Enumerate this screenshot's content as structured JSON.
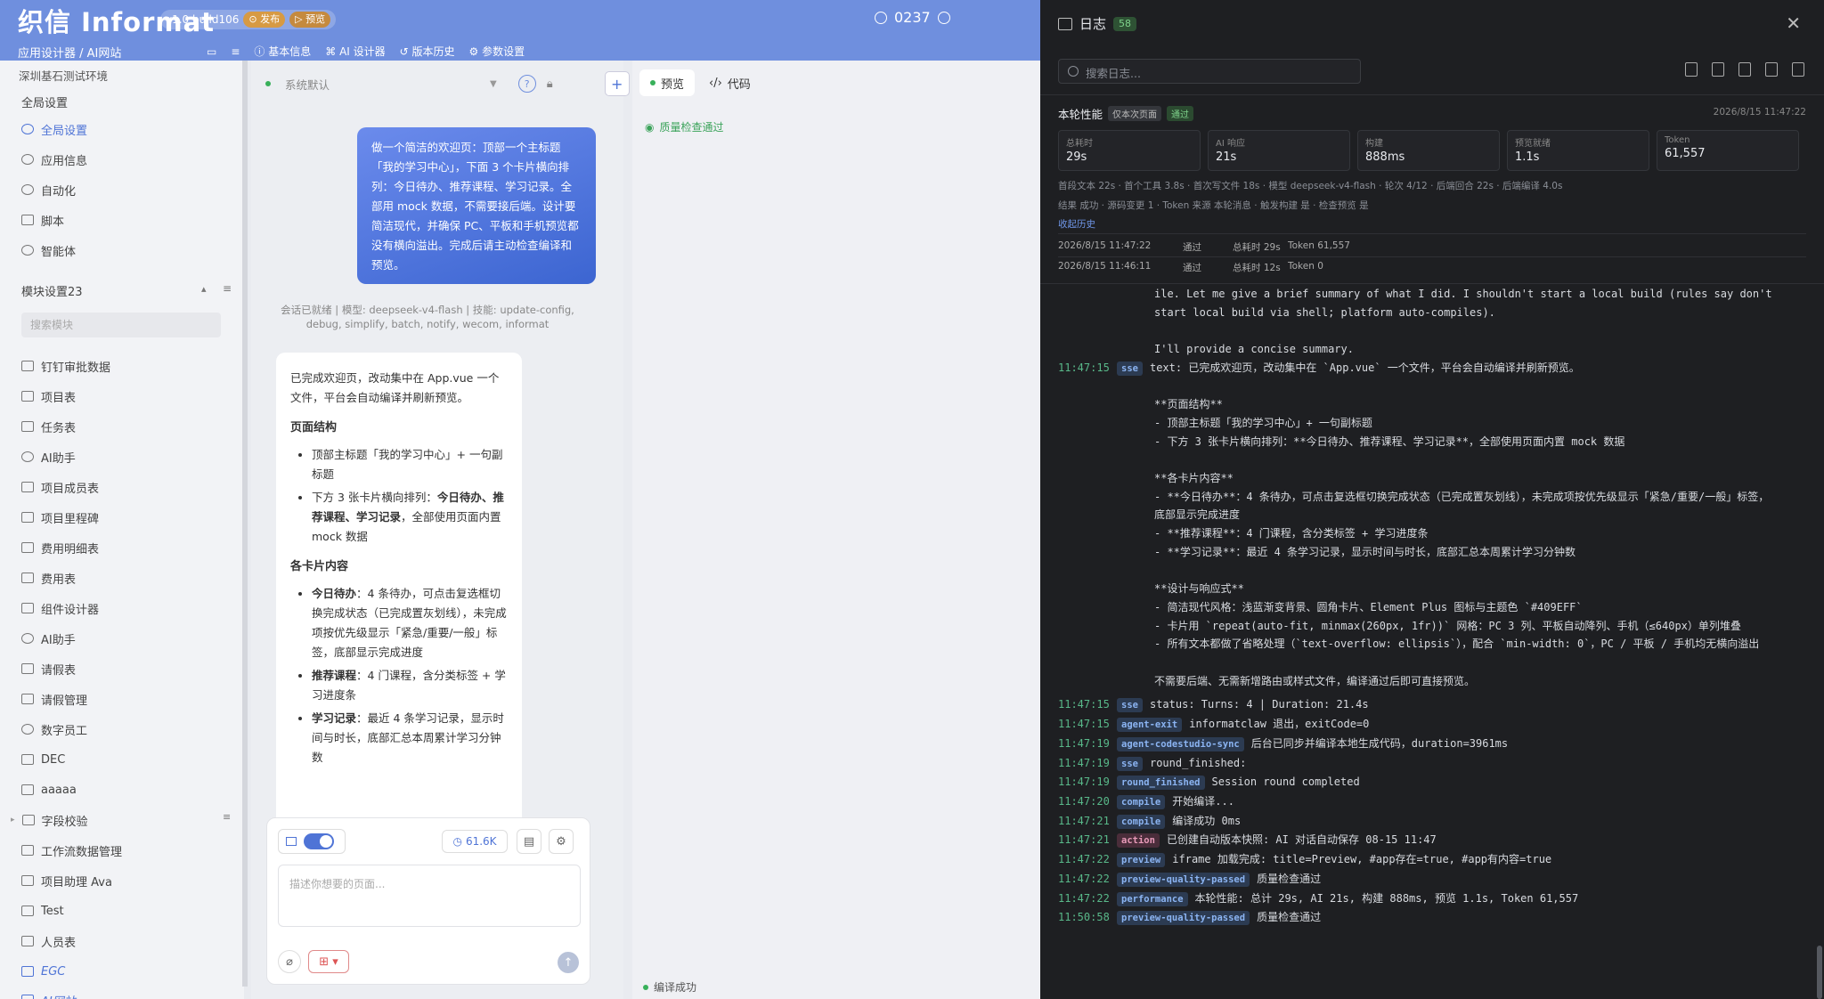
{
  "app": {
    "logo": "织信 Informat",
    "version": "v1.0 build106",
    "publish": "发布",
    "preview": "预览",
    "counter": "0237",
    "breadcrumb": "应用设计器 / AI网站",
    "nav": [
      "基本信息",
      "AI 设计器",
      "版本历史",
      "参数设置"
    ]
  },
  "sidebar": {
    "env": "深圳基石测试环境",
    "global_header": "全局设置",
    "global_items": [
      "全局设置",
      "应用信息",
      "自动化",
      "脚本",
      "智能体"
    ],
    "module_header": "模块设置23",
    "search_placeholder": "搜索模块",
    "items": [
      "钉钉审批数据",
      "项目表",
      "任务表",
      "AI助手",
      "项目成员表",
      "项目里程碑",
      "费用明细表",
      "费用表",
      "组件设计器",
      "AI助手",
      "请假表",
      "请假管理",
      "数字员工",
      "DEC",
      "aaaaa",
      "字段校验",
      "工作流数据管理",
      "项目助理 Ava",
      "Test",
      "人员表",
      "EGC",
      "AI网站"
    ]
  },
  "chat": {
    "model": "系统默认",
    "user_msg": "做一个简洁的欢迎页：顶部一个主标题「我的学习中心」，下面 3 个卡片横向排列：今日待办、推荐课程、学习记录。全部用 mock 数据，不需要接后端。设计要简洁现代，并确保 PC、平板和手机预览都没有横向溢出。完成后请主动检查编译和预览。",
    "session": "会话已就绪 | 模型: deepseek-v4-flash | 技能: update-config, debug, simplify, batch, notify, wecom, informat",
    "reply_intro": "已完成欢迎页，改动集中在 App.vue 一个文件，平台会自动编译并刷新预览。",
    "h1": "页面结构",
    "l1a": "顶部主标题「我的学习中心」+ 一句副标题",
    "l1b_pre": "下方 3 张卡片横向排列：",
    "l1b_bold": "今日待办、推荐课程、学习记录",
    "l1b_post": "，全部使用页面内置 mock 数据",
    "h2": "各卡片内容",
    "c1b": "今日待办",
    "c1": "：4 条待办，可点击复选框切换完成状态（已完成置灰划线），未完成项按优先级显示「紧急/重要/一般」标签，底部显示完成进度",
    "c2b": "推荐课程",
    "c2": "：4 门课程，含分类标签 + 学习进度条",
    "c3b": "学习记录",
    "c3": "：最近 4 条学习记录，显示时间与时长，底部汇总本周累计学习分钟数",
    "token": "61.6K",
    "input_placeholder": "描述你想要的页面..."
  },
  "preview_panel": {
    "tab_preview": "预览",
    "tab_code": "代码",
    "quality": "质量检查通过",
    "compile_status": "编译成功"
  },
  "log": {
    "title": "日志",
    "count": "58",
    "search_placeholder": "搜索日志...",
    "perf_title": "本轮性能",
    "perf_tag1": "仅本次页面",
    "perf_tag2": "通过",
    "perf_time": "2026/8/15 11:47:22",
    "cards": [
      {
        "k": "总耗时",
        "v": "29s"
      },
      {
        "k": "AI 响应",
        "v": "21s"
      },
      {
        "k": "构建",
        "v": "888ms"
      },
      {
        "k": "预览就绪",
        "v": "1.1s"
      },
      {
        "k": "Token",
        "v": "61,557"
      }
    ],
    "meta1": "首段文本 22s · 首个工具 3.8s · 首次写文件 18s · 模型 deepseek-v4-flash · 轮次 4/12 · 后端回合 22s · 后端编译 4.0s",
    "meta2": "结果 成功 · 源码变更 1 · Token 来源 本轮消息 · 触发构建 是 · 检查预览 是",
    "collapse": "收起历史",
    "history": [
      {
        "time": "2026/8/15 11:47:22",
        "status": "通过",
        "total": "总耗时 29s",
        "token": "Token 61,557"
      },
      {
        "time": "2026/8/15 11:46:11",
        "status": "通过",
        "total": "总耗时 12s",
        "token": "Token 0"
      }
    ],
    "pre_lines": [
      "ile. Let me give a brief summary of what I did. I shouldn't start a local build (rules say don't",
      "start local build via shell; platform auto-compiles).",
      "",
      "I'll provide a concise summary."
    ],
    "sse1": {
      "time": "11:47:15",
      "tag": "sse",
      "text": "text: 已完成欢迎页，改动集中在 `App.vue` 一个文件，平台会自动编译并刷新预览。"
    },
    "sse1_body": [
      "",
      "**页面结构**",
      "- 顶部主标题「我的学习中心」+ 一句副标题",
      "- 下方 3 张卡片横向排列：**今日待办、推荐课程、学习记录**，全部使用页面内置 mock 数据",
      "",
      "**各卡片内容**",
      "- **今日待办**：4 条待办，可点击复选框切换完成状态（已完成置灰划线），未完成项按优先级显示「紧急/重要/一般」标签，",
      "底部显示完成进度",
      "- **推荐课程**：4 门课程，含分类标签 + 学习进度条",
      "- **学习记录**：最近 4 条学习记录，显示时间与时长，底部汇总本周累计学习分钟数",
      "",
      "**设计与响应式**",
      "- 简洁现代风格：浅蓝渐变背景、圆角卡片、Element Plus 图标与主题色 `#409EFF`",
      "- 卡片用 `repeat(auto-fit, minmax(260px, 1fr))` 网格：PC 3 列、平板自动降列、手机（≤640px）单列堆叠",
      "- 所有文本都做了省略处理（`text-overflow: ellipsis`），配合 `min-width: 0`，PC / 平板 / 手机均无横向溢出",
      "",
      "不需要后端、无需新增路由或样式文件，编译通过后即可直接预览。"
    ],
    "entries": [
      {
        "time": "11:47:15",
        "tag": "sse",
        "text": "status: Turns: 4 | Duration: 21.4s"
      },
      {
        "time": "11:47:15",
        "tag": "agent-exit",
        "text": "informatclaw 退出，exitCode=0"
      },
      {
        "time": "11:47:19",
        "tag": "agent-codestudio-sync",
        "text": "后台已同步并编译本地生成代码，duration=3961ms"
      },
      {
        "time": "11:47:19",
        "tag": "sse",
        "text": "round_finished:"
      },
      {
        "time": "11:47:19",
        "tag": "round_finished",
        "text": "Session round completed"
      },
      {
        "time": "11:47:20",
        "tag": "compile",
        "text": "开始编译..."
      },
      {
        "time": "11:47:21",
        "tag": "compile",
        "text": "编译成功 0ms"
      },
      {
        "time": "11:47:21",
        "tag": "action",
        "text": "已创建自动版本快照: AI 对话自动保存 08-15 11:47"
      },
      {
        "time": "11:47:22",
        "tag": "preview",
        "text": "iframe 加载完成: title=Preview, #app存在=true, #app有内容=true"
      },
      {
        "time": "11:47:22",
        "tag": "preview-quality-passed",
        "text": "质量检查通过"
      },
      {
        "time": "11:47:22",
        "tag": "performance",
        "text": "本轮性能: 总计 29s, AI 21s, 构建 888ms, 预览 1.1s, Token 61,557"
      },
      {
        "time": "11:50:58",
        "tag": "preview-quality-passed",
        "text": "质量检查通过"
      }
    ]
  },
  "colors": {
    "accent": "#4f74d6",
    "header": "#6f8fde",
    "log_bg": "#1e1f22",
    "ok": "#38b05a"
  }
}
